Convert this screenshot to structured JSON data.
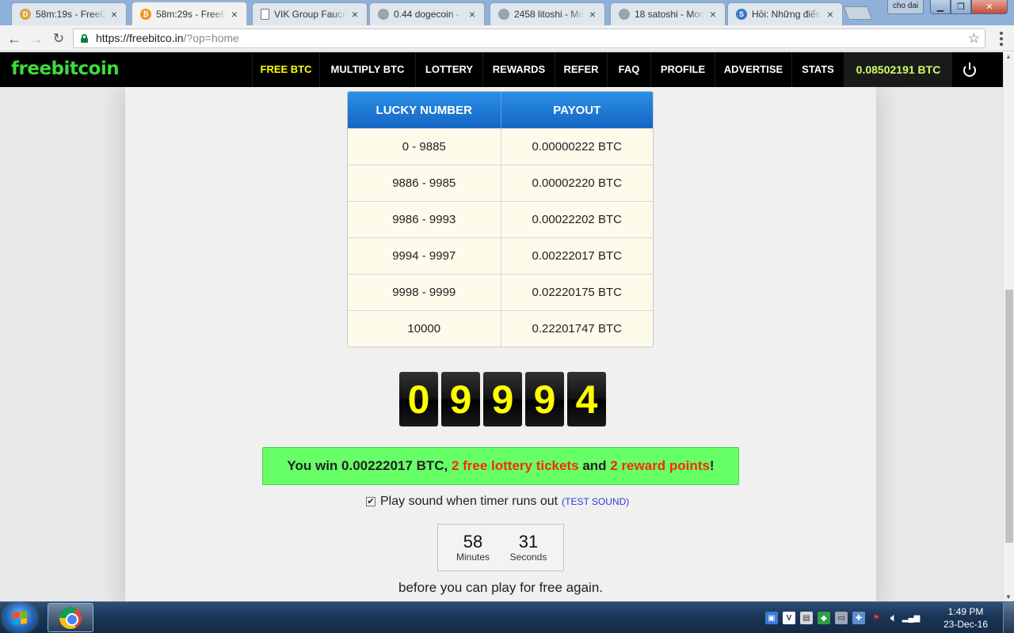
{
  "browser": {
    "tabs": [
      {
        "title": "58m:19s - FreeD",
        "favicon": "coin-icon",
        "color": "#d9a441",
        "glyph": "D"
      },
      {
        "title": "58m:29s - FreeBi",
        "favicon": "bitcoin-icon",
        "color": "#f7931a",
        "glyph": "₿"
      },
      {
        "title": "VIK Group Fauce",
        "favicon": "document-icon",
        "color": "#ffffff",
        "glyph": ""
      },
      {
        "title": "0.44 dogecoin - ",
        "favicon": "coin-icon",
        "color": "#9aa4ad",
        "glyph": ""
      },
      {
        "title": "2458 litoshi - Mo",
        "favicon": "coin-icon",
        "color": "#9aa4ad",
        "glyph": ""
      },
      {
        "title": "18 satoshi - Moo",
        "favicon": "coin-icon",
        "color": "#9aa4ad",
        "glyph": ""
      },
      {
        "title": "Hỏi: Những điểm",
        "favicon": "s-icon",
        "color": "#3a78c8",
        "glyph": "S"
      }
    ],
    "active_tab": 1,
    "profile_name": "cho dai",
    "url_host": "https://freebitco.in",
    "url_path": "/?op=home"
  },
  "site": {
    "logo": "freebitcoin",
    "nav": [
      "FREE BTC",
      "MULTIPLY BTC",
      "LOTTERY",
      "REWARDS",
      "REFER",
      "FAQ",
      "PROFILE",
      "ADVERTISE",
      "STATS"
    ],
    "balance": "0.08502191 BTC"
  },
  "payout_table": {
    "headers": [
      "LUCKY NUMBER",
      "PAYOUT"
    ],
    "rows": [
      [
        "0 - 9885",
        "0.00000222 BTC"
      ],
      [
        "9886 - 9985",
        "0.00002220 BTC"
      ],
      [
        "9986 - 9993",
        "0.00022202 BTC"
      ],
      [
        "9994 - 9997",
        "0.00222017 BTC"
      ],
      [
        "9998 - 9999",
        "0.02220175 BTC"
      ],
      [
        "10000",
        "0.22201747 BTC"
      ]
    ]
  },
  "roll_digits": [
    "0",
    "9",
    "9",
    "9",
    "4"
  ],
  "result": {
    "prefix": "You win 0.00222017 BTC, ",
    "tickets": "2 free lottery tickets",
    "middle": " and ",
    "points": "2 reward points",
    "suffix": "!"
  },
  "sound": {
    "checked": true,
    "label": "Play sound when timer runs out",
    "test_link": "(TEST SOUND)"
  },
  "timer": {
    "minutes": "58",
    "minutes_label": "Minutes",
    "seconds": "31",
    "seconds_label": "Seconds"
  },
  "again_text": "before you can play for free again.",
  "taskbar": {
    "time": "1:49 PM",
    "date": "23-Dec-16"
  }
}
